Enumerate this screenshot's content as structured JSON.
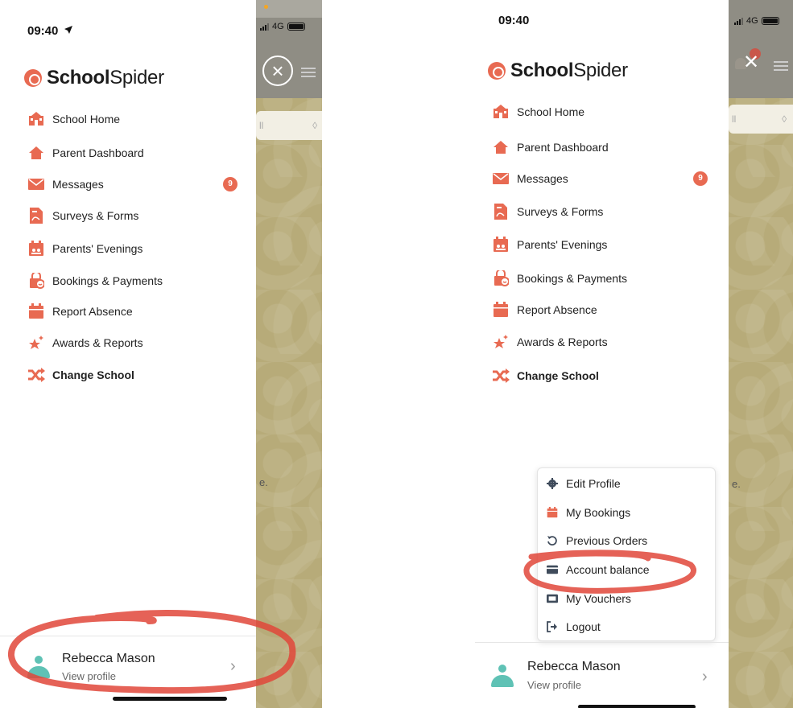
{
  "colors": {
    "brand": "#e86a52",
    "avatar": "#5fc2b5",
    "annotation": "#e0463a",
    "backdrop": "#b7ab79"
  },
  "left": {
    "status_time": "09:40",
    "network": "4G",
    "logo": {
      "bold": "School",
      "regular": "Spider"
    },
    "menu": [
      {
        "label": "School Home",
        "icon": "school-icon"
      },
      {
        "label": "Parent Dashboard",
        "icon": "home-icon"
      },
      {
        "label": "Messages",
        "icon": "envelope-icon",
        "badge": "9"
      },
      {
        "label": "Surveys & Forms",
        "icon": "document-icon"
      },
      {
        "label": "Parents' Evenings",
        "icon": "calendar-people-icon"
      },
      {
        "label": "Bookings & Payments",
        "icon": "bag-icon"
      },
      {
        "label": "Report Absence",
        "icon": "calendar-icon"
      },
      {
        "label": "Awards & Reports",
        "icon": "star-icon"
      },
      {
        "label": "Change School",
        "icon": "shuffle-icon"
      }
    ],
    "backdrop_text": "e.",
    "profile": {
      "name": "Rebecca Mason",
      "sub": "View profile"
    }
  },
  "right": {
    "status_time": "09:40",
    "network": "4G",
    "logo": {
      "bold": "School",
      "regular": "Spider"
    },
    "menu": [
      {
        "label": "School Home",
        "icon": "school-icon"
      },
      {
        "label": "Parent Dashboard",
        "icon": "home-icon"
      },
      {
        "label": "Messages",
        "icon": "envelope-icon",
        "badge": "9"
      },
      {
        "label": "Surveys & Forms",
        "icon": "document-icon"
      },
      {
        "label": "Parents' Evenings",
        "icon": "calendar-people-icon"
      },
      {
        "label": "Bookings & Payments",
        "icon": "bag-icon"
      },
      {
        "label": "Report Absence",
        "icon": "calendar-icon"
      },
      {
        "label": "Awards & Reports",
        "icon": "star-icon"
      },
      {
        "label": "Change School",
        "icon": "shuffle-icon"
      }
    ],
    "popup": [
      {
        "label": "Edit Profile",
        "icon": "gear-icon"
      },
      {
        "label": "My Bookings",
        "icon": "calendar-icon"
      },
      {
        "label": "Previous Orders",
        "icon": "history-icon"
      },
      {
        "label": "Account balance",
        "icon": "credit-card-icon"
      },
      {
        "label": "My Vouchers",
        "icon": "voucher-icon"
      },
      {
        "label": "Logout",
        "icon": "logout-icon"
      }
    ],
    "backdrop_text": "e.",
    "profile": {
      "name": "Rebecca Mason",
      "sub": "View profile"
    }
  }
}
